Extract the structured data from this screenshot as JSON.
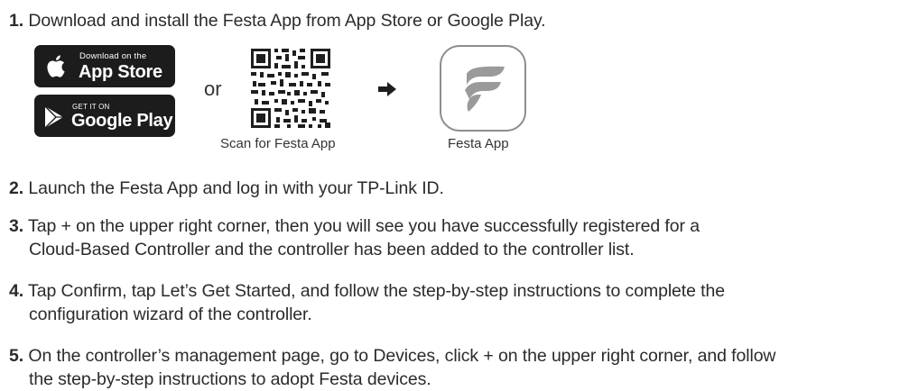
{
  "steps": {
    "s1": {
      "num": "1.",
      "text": "Download and install the Festa App from App Store or Google Play."
    },
    "s2": {
      "num": "2.",
      "text": "Launch the Festa App and log in with your TP-Link ID."
    },
    "s3": {
      "num": "3.",
      "line1": "Tap + on the upper right corner, then you will see you have successfully registered for a",
      "line2": "Cloud-Based Controller and the controller has been added to the controller list."
    },
    "s4": {
      "num": "4.",
      "pre": "Tap ",
      "confirm": "Confirm",
      "mid": ", tap ",
      "started": "Let’s Get Started,",
      "post": " and follow the step-by-step instructions to complete the",
      "line2": "configuration wizard of the controller."
    },
    "s5": {
      "num": "5.",
      "pre": "On the controller’s management page, go to ",
      "devices": "Devices",
      "post": ", click + on the upper right corner, and follow",
      "line2": "the step-by-step instructions to adopt Festa devices."
    }
  },
  "badges": {
    "appstore": {
      "small": "Download on the",
      "big": "App Store",
      "icon": "apple-icon"
    },
    "googleplay": {
      "small": "GET IT ON",
      "big": "Google Play",
      "icon": "play-icon"
    }
  },
  "or_text": "or",
  "qr_caption": "Scan for Festa App",
  "app_caption": "Festa App",
  "colors": {
    "text": "#2b2b2b",
    "badge_bg": "#1c1c1c",
    "icon_border": "#8d8d8d",
    "logo_gray": "#9a9a9a"
  }
}
